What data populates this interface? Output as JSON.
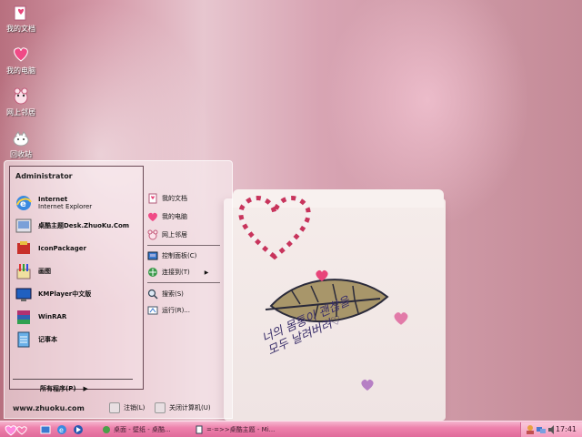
{
  "desktop": {
    "icons": [
      {
        "label": "我的文档",
        "icon": "my-documents-icon"
      },
      {
        "label": "我的电脑",
        "icon": "my-computer-icon"
      },
      {
        "label": "网上邻居",
        "icon": "network-places-icon"
      },
      {
        "label": "回收站",
        "icon": "recycle-bin-icon"
      }
    ],
    "wallpaper_text": [
      "너의 몸통이 괜찮을",
      "모두 날려버려♡"
    ]
  },
  "start_menu": {
    "user": "Administrator",
    "programs": [
      {
        "title": "Internet",
        "subtitle": "Internet Explorer",
        "icon": "internet-explorer-icon"
      },
      {
        "title": "桌酷主题Desk.ZhuoKu.Com",
        "subtitle": "",
        "icon": "zhuoku-theme-icon"
      },
      {
        "title": "IconPackager",
        "subtitle": "",
        "icon": "iconpackager-icon"
      },
      {
        "title": "画图",
        "subtitle": "",
        "icon": "paint-icon"
      },
      {
        "title": "KMPlayer中文版",
        "subtitle": "",
        "icon": "kmplayer-icon"
      },
      {
        "title": "WinRAR",
        "subtitle": "",
        "icon": "winrar-icon"
      },
      {
        "title": "记事本",
        "subtitle": "",
        "icon": "notepad-icon"
      }
    ],
    "all_programs": "所有程序(P)",
    "right_items": [
      {
        "label": "我的文档",
        "icon": "my-documents-icon"
      },
      {
        "label": "我的电脑",
        "icon": "my-computer-icon"
      },
      {
        "label": "网上邻居",
        "icon": "network-places-icon"
      },
      {
        "label": "控制面板(C)",
        "icon": "control-panel-icon"
      },
      {
        "label": "连接到(T)",
        "icon": "connect-to-icon"
      },
      {
        "label": "搜索(S)",
        "icon": "search-icon"
      },
      {
        "label": "运行(R)...",
        "icon": "run-icon"
      }
    ],
    "site_url": "www.zhuoku.com",
    "logoff": "注销(L)",
    "shutdown": "关闭计算机(U)"
  },
  "taskbar": {
    "tasks": [
      {
        "label": "桌面 - 壁纸 - 桌酷...",
        "icon": "browser-icon"
      },
      {
        "label": "=·=>>桌酷主题 - Mi...",
        "icon": "document-icon"
      }
    ],
    "clock": "17:41"
  },
  "colors": {
    "taskbar_pink": "#ee82ad",
    "heart_pink": "#e8457a",
    "wallpaper_pink": "#d59aa9"
  }
}
